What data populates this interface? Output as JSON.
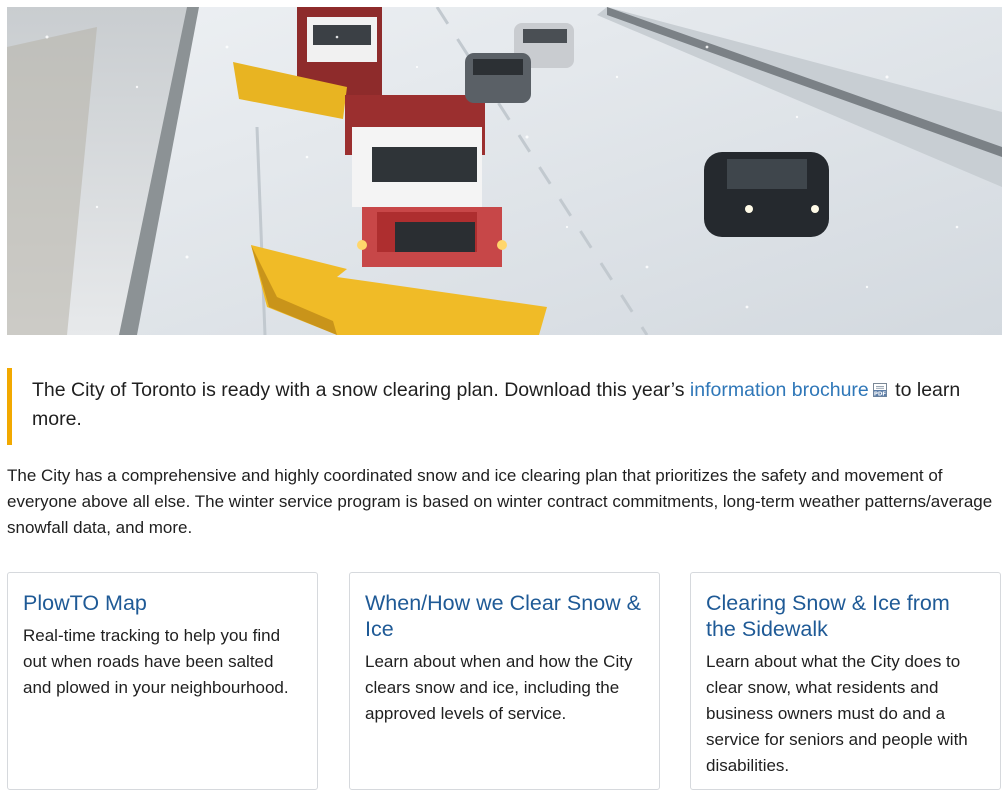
{
  "hero": {
    "alt": "Snow plows clearing a highway during a snowstorm"
  },
  "callout": {
    "text_before": "The City of Toronto is ready with a snow clearing plan. Download this year’s ",
    "link_label": "information brochure",
    "pdf_icon": "pdf-file-icon",
    "text_after": " to learn more."
  },
  "intro": {
    "text": "The City has a comprehensive and highly coordinated snow and ice clearing plan that prioritizes the safety and movement of everyone above all else. The winter service program is based on winter contract commitments, long-term weather patterns/average snowfall data, and more."
  },
  "cards": [
    {
      "title": "PlowTO Map",
      "description": "Real-time tracking to help you find out when roads have been salted and plowed in your neighbourhood."
    },
    {
      "title": "When/How we Clear Snow & Ice",
      "description": "Learn about when and how the City clears snow and ice, including the approved levels of service."
    },
    {
      "title": "Clearing Snow & Ice from the Sidewalk",
      "description": "Learn about what the City does to clear snow, what residents and business owners must do and a service for seniors and people with disabilities."
    }
  ],
  "colors": {
    "accent_bar": "#f2a900",
    "link": "#2f77b8",
    "card_title": "#1f5a96"
  }
}
